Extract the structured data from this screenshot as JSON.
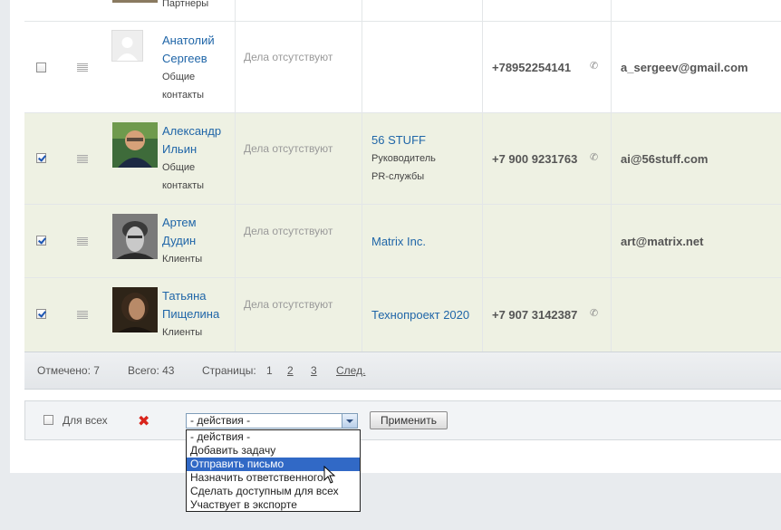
{
  "rows": [
    {
      "partial_sub": "Партнеры"
    },
    {
      "first": "Анатолий",
      "last": "Сергеев",
      "sub1": "Общие",
      "sub2": "контакты",
      "activities": "Дела отсутствуют",
      "company": "",
      "role1": "",
      "role2": "",
      "phone": "+78952254141",
      "email": "a_sergeev@gmail.com",
      "checked": false,
      "avatar": "default-avatar-icon"
    },
    {
      "first": "Александр",
      "last": "Ильин",
      "sub1": "Общие",
      "sub2": "контакты",
      "activities": "Дела отсутствуют",
      "company": "56 STUFF",
      "role1": "Руководитель",
      "role2": "PR-службы",
      "phone": "+7 900 9231763",
      "email": "ai@56stuff.com",
      "checked": true,
      "avatar": "photo-avatar-icon"
    },
    {
      "first": "Артем",
      "last": "Дудин",
      "sub1": "Клиенты",
      "activities": "Дела отсутствуют",
      "company": "Matrix Inc.",
      "phone": "",
      "email": "art@matrix.net",
      "checked": true,
      "avatar": "photo-avatar-icon"
    },
    {
      "first": "Татьяна",
      "last": "Пищелина",
      "sub1": "Клиенты",
      "activities": "Дела отсутствуют",
      "company": "Технопроект 2020",
      "phone": "+7 907 3142387",
      "email": "",
      "checked": true,
      "avatar": "photo-avatar-icon"
    }
  ],
  "footer": {
    "marked": "Отмечено: 7",
    "total": "Всего: 43",
    "pages_label": "Страницы:",
    "page1": "1",
    "page2": "2",
    "page3": "3",
    "next": "След."
  },
  "actions": {
    "for_all": "Для всех",
    "select_value": "- действия -",
    "apply": "Применить",
    "options": [
      "- действия -",
      "Добавить задачу",
      "Отправить письмо",
      "Назначить ответственного",
      "Сделать доступным для всех",
      "Участвует в экспорте"
    ],
    "highlighted_index": 2
  },
  "colors": {
    "link": "#2066a8",
    "selected_row": "#eef1e3",
    "highlight": "#3169c6",
    "delete": "#d9241b"
  }
}
